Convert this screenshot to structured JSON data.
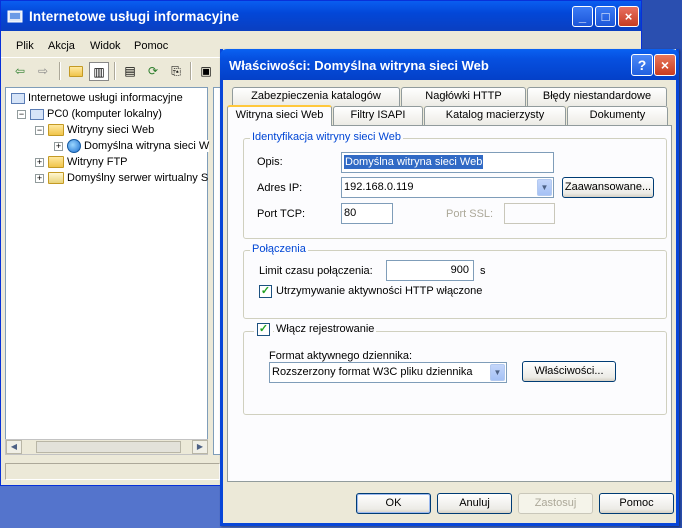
{
  "main_window": {
    "title": "Internetowe usługi informacyjne",
    "caption_buttons": {
      "minimize": "_",
      "maximize": "□",
      "close": "×"
    },
    "menu": [
      "Plik",
      "Akcja",
      "Widok",
      "Pomoc"
    ],
    "toolbar_icons": [
      "back-arrow-icon",
      "forward-arrow-icon",
      "up-folder-icon",
      "show-hide-tree-icon",
      "properties-icon",
      "refresh-icon",
      "export-list-icon",
      "help-icon"
    ],
    "tree": [
      {
        "label": "Internetowe usługi informacyjne",
        "level": 0,
        "icon": "iis-icon",
        "expander": ""
      },
      {
        "label": "PC0 (komputer lokalny)",
        "level": 1,
        "icon": "computer-icon",
        "expander": "−"
      },
      {
        "label": "Witryny sieci Web",
        "level": 2,
        "icon": "folder-icon",
        "expander": "−"
      },
      {
        "label": "Domyślna witryna sieci W",
        "level": 3,
        "icon": "web-site-icon",
        "expander": "+"
      },
      {
        "label": "Witryny FTP",
        "level": 2,
        "icon": "folder-icon",
        "expander": "+"
      },
      {
        "label": "Domyślny serwer wirtualny S",
        "level": 2,
        "icon": "smtp-icon",
        "expander": "+"
      }
    ]
  },
  "dialog": {
    "title": "Właściwości: Domyślna witryna sieci Web",
    "caption_buttons": {
      "help": "?",
      "close": "×"
    },
    "tabs_row1": [
      "Zabezpieczenia katalogów",
      "Nagłówki HTTP",
      "Błędy niestandardowe"
    ],
    "tabs_row2": [
      "Witryna sieci Web",
      "Filtry ISAPI",
      "Katalog macierzysty",
      "Dokumenty"
    ],
    "active_tab": "Witryna sieci Web",
    "identification": {
      "legend": "Identyfikacja witryny sieci Web",
      "description_label": "Opis:",
      "description_value": "Domyślna witryna sieci Web",
      "ip_label": "Adres IP:",
      "ip_value": "192.168.0.119",
      "advanced_button": "Zaawansowane...",
      "tcp_label": "Port TCP:",
      "tcp_value": "80",
      "ssl_label": "Port SSL:",
      "ssl_value": ""
    },
    "connections": {
      "legend": "Połączenia",
      "timeout_label": "Limit czasu połączenia:",
      "timeout_value": "900",
      "timeout_unit": "s",
      "keepalive_label": "Utrzymywanie aktywności HTTP włączone",
      "keepalive_checked": true
    },
    "logging": {
      "enable_label": "Włącz rejestrowanie",
      "enable_checked": true,
      "format_label": "Format aktywnego dziennika:",
      "format_value": "Rozszerzony format W3C pliku dziennika",
      "properties_button": "Właściwości..."
    },
    "buttons": {
      "ok": "OK",
      "cancel": "Anuluj",
      "apply": "Zastosuj",
      "help": "Pomoc"
    }
  }
}
